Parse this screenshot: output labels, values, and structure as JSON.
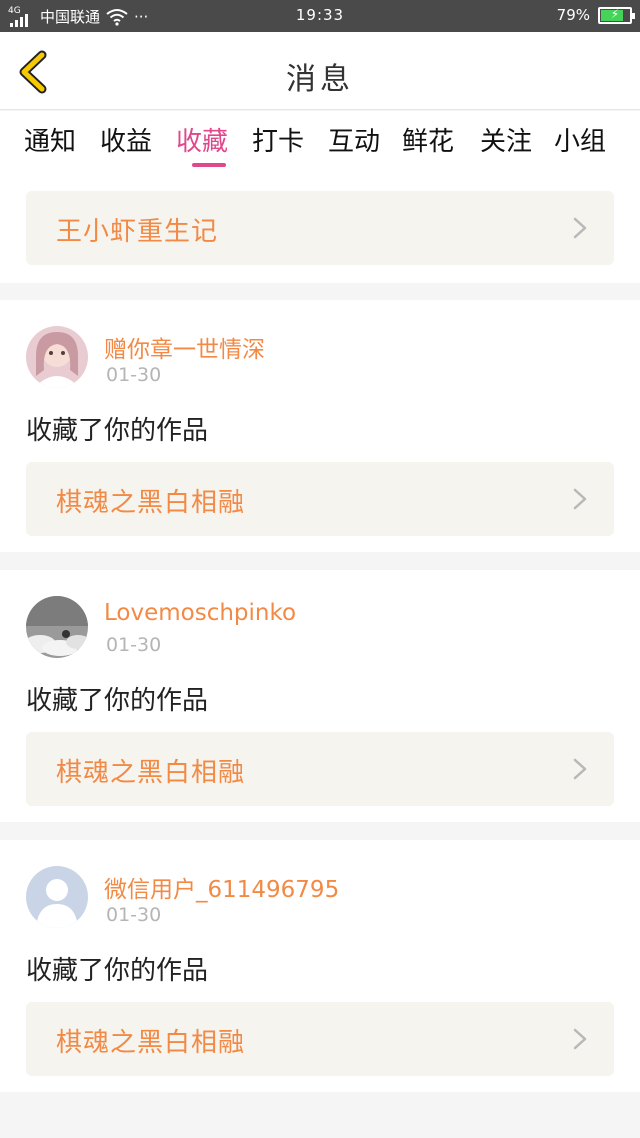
{
  "status_bar": {
    "network": "4G",
    "carrier": "中国联通",
    "dots": "···",
    "time": "19:33",
    "battery": "79%",
    "battery_level": 0.79
  },
  "header": {
    "title": "消息"
  },
  "tabs": [
    {
      "label": "通知"
    },
    {
      "label": "收益"
    },
    {
      "label": "收藏",
      "active": true
    },
    {
      "label": "打卡"
    },
    {
      "label": "互动"
    },
    {
      "label": "鲜花"
    },
    {
      "label": "关注"
    },
    {
      "label": "小组"
    }
  ],
  "top_item": {
    "title": "王小虾重生记"
  },
  "messages": [
    {
      "user": "赠你章一世情深",
      "date": "01-30",
      "action": "收藏了你的作品",
      "work": "棋魂之黑白相融",
      "avatar": "girl-photo"
    },
    {
      "user": "Lovemoschpinko",
      "date": "01-30",
      "action": "收藏了你的作品",
      "work": "棋魂之黑白相融",
      "avatar": "sky-photo"
    },
    {
      "user": "微信用户_611496795",
      "date": "01-30",
      "action": "收藏了你的作品",
      "work": "棋魂之黑白相融",
      "avatar": "default-user"
    }
  ],
  "colors": {
    "accent_pink": "#e0488c",
    "accent_orange": "#f28a46",
    "back_yellow": "#f6c900"
  }
}
